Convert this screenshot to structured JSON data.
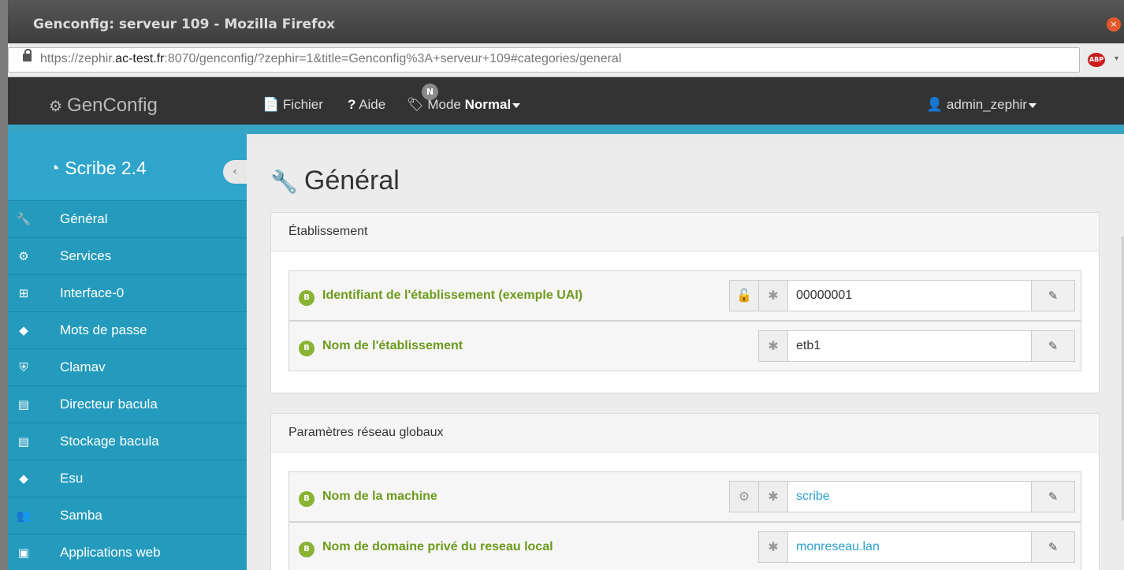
{
  "window": {
    "title": "Genconfig: serveur 109 - Mozilla Firefox",
    "close_glyph": "×"
  },
  "browser": {
    "url_prefix": "https://zephir.",
    "url_domain": "ac-test.fr",
    "url_rest": ":8070/genconfig/?zephir=1&title=Genconfig%3A+serveur+109#categories/general",
    "addon": "ABP",
    "menu_glyph": "▾"
  },
  "topnav": {
    "brand": "GenConfig",
    "fichier": "Fichier",
    "aide": "Aide",
    "mode_label": "Mode",
    "mode_value": "Normal",
    "mode_badge": "N",
    "user": "admin_zephir"
  },
  "sidebar": {
    "title": "Scribe 2.4",
    "collapse_glyph": "‹",
    "items": [
      {
        "label": "Général",
        "icon": "wrench-icon"
      },
      {
        "label": "Services",
        "icon": "cogs-icon"
      },
      {
        "label": "Interface-0",
        "icon": "sitemap-icon"
      },
      {
        "label": "Mots de passe",
        "icon": "tags-icon"
      },
      {
        "label": "Clamav",
        "icon": "shield-icon"
      },
      {
        "label": "Directeur bacula",
        "icon": "archive-icon"
      },
      {
        "label": "Stockage bacula",
        "icon": "archive-icon"
      },
      {
        "label": "Esu",
        "icon": "tags-icon"
      },
      {
        "label": "Samba",
        "icon": "users-icon"
      },
      {
        "label": "Applications web",
        "icon": "web-app-icon"
      }
    ]
  },
  "main": {
    "title": "Général",
    "panels": [
      {
        "heading": "Établissement",
        "fields": [
          {
            "badge": "B",
            "label": "Identifiant de l'établissement (exemple UAI)",
            "value": "00000001"
          },
          {
            "badge": "B",
            "label": "Nom de l'établissement",
            "value": "etb1"
          }
        ]
      },
      {
        "heading": "Paramètres réseau globaux",
        "fields": [
          {
            "badge": "B",
            "label": "Nom de la machine",
            "value": "scribe"
          },
          {
            "badge": "B",
            "label": "Nom de domaine privé du reseau local",
            "value": "monreseau.lan"
          }
        ]
      }
    ]
  },
  "colors": {
    "sidebar": "#2fa5cb",
    "navbar": "#333333",
    "label_green": "#6d9a1c",
    "value_blue": "#2ba0cd"
  }
}
